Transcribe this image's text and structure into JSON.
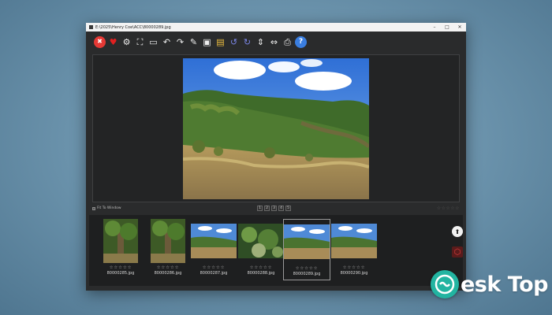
{
  "window": {
    "title": "E:\\2025\\Henry Coe\\ACC\\80000289.jpg",
    "controls": [
      "–",
      "□",
      "✕"
    ]
  },
  "toolbar": {
    "icons": [
      {
        "name": "delete-icon",
        "glyph": "✖",
        "color": "#e53935"
      },
      {
        "name": "favorite-heart-icon",
        "glyph": "♥",
        "color": "#e02020"
      },
      {
        "name": "settings-icon",
        "glyph": "⚙",
        "color": "#eeeeee"
      },
      {
        "name": "fullscreen-icon",
        "glyph": "⛶",
        "color": "#eeeeee"
      },
      {
        "name": "slideshow-icon",
        "glyph": "▭",
        "color": "#eeeeee"
      },
      {
        "name": "rotate-left-icon",
        "glyph": "↶",
        "color": "#eeeeee"
      },
      {
        "name": "rotate-right-icon",
        "glyph": "↷",
        "color": "#eeeeee"
      },
      {
        "name": "edit-icon",
        "glyph": "✎",
        "color": "#eeeeee"
      },
      {
        "name": "save-icon",
        "glyph": "▣",
        "color": "#eeeeee"
      },
      {
        "name": "save-as-icon",
        "glyph": "▤",
        "color": "#f0c040"
      },
      {
        "name": "undo-icon",
        "glyph": "↺",
        "color": "#7b86e8"
      },
      {
        "name": "redo-icon",
        "glyph": "↻",
        "color": "#7b86e8"
      },
      {
        "name": "flip-vertical-icon",
        "glyph": "⇕",
        "color": "#eeeeee"
      },
      {
        "name": "flip-horizontal-icon",
        "glyph": "⇔",
        "color": "#eeeeee"
      },
      {
        "name": "print-icon",
        "glyph": "⎙",
        "color": "#eeeeee"
      },
      {
        "name": "help-icon",
        "glyph": "?",
        "color": "#ffffff"
      }
    ]
  },
  "status": {
    "fit_label": "Fit To Window",
    "pages": [
      "1",
      "2",
      "3",
      "4",
      "5"
    ],
    "rating": "☆☆☆☆☆"
  },
  "thumbnails": [
    {
      "name": "80000285.jpg",
      "stars": "☆☆☆☆☆",
      "scene": "tree"
    },
    {
      "name": "80000286.jpg",
      "stars": "☆☆☆☆☆",
      "scene": "tree"
    },
    {
      "name": "80000287.jpg",
      "stars": "☆☆☆☆☆",
      "scene": "hill"
    },
    {
      "name": "80000288.jpg",
      "stars": "☆☆☆☆☆",
      "scene": "brush"
    },
    {
      "name": "80000289.jpg",
      "stars": "☆☆☆☆☆",
      "scene": "hill",
      "selected": true
    },
    {
      "name": "80000290.jpg",
      "stars": "☆☆☆☆☆",
      "scene": "hill"
    }
  ],
  "side_buttons": [
    {
      "name": "upload-icon",
      "glyph": "⬆"
    },
    {
      "name": "ftp-icon",
      "glyph": "⬡"
    }
  ],
  "watermark": {
    "text": "esk Top",
    "brand_color": "#22b4a1"
  }
}
